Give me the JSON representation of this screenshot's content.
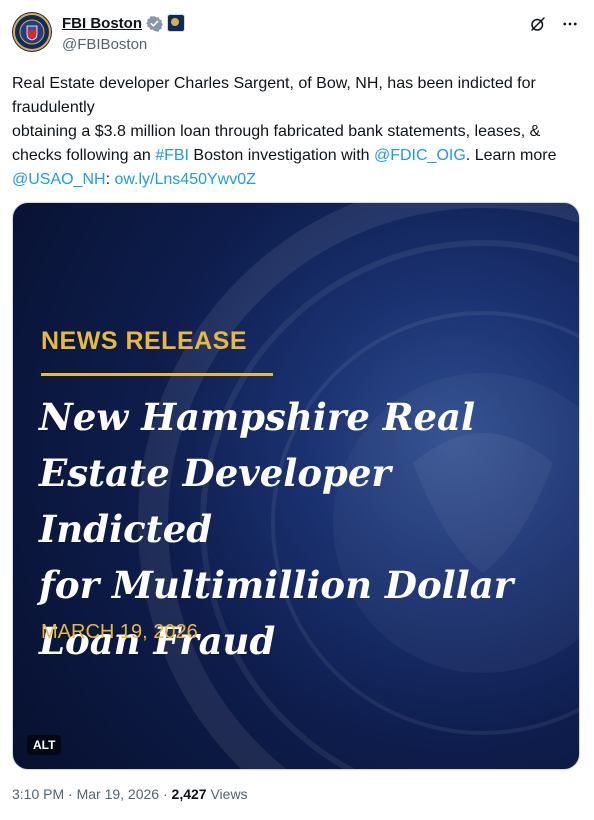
{
  "account": {
    "name": "FBI Boston",
    "handle": "@FBIBoston"
  },
  "tweet": {
    "line1": "Real Estate developer Charles Sargent, of Bow, NH, has been indicted for fraudulently",
    "line2_pre": "obtaining a $3.8 million loan through fabricated bank statements, leases, & checks following an ",
    "hashtag": "#FBI",
    "line2_mid": " Boston investigation with ",
    "mention1": "@FDIC_OIG",
    "line2_post": ". Learn more ",
    "mention2": "@USAO_NH",
    "colon": ": ",
    "url": "ow.ly/Lns450Ywv0Z"
  },
  "media": {
    "label": "NEWS RELEASE",
    "headline_lines": [
      "New Hampshire Real",
      "Estate Developer Indicted",
      "for Multimillion Dollar",
      "Loan Fraud"
    ],
    "date": "MARCH 19, 2026",
    "alt": "ALT"
  },
  "meta": {
    "time": "3:10 PM · Mar 19, 2026 · ",
    "views_count": "2,427",
    "views_label": " Views"
  },
  "icons": {
    "verified": "verified-badge-icon",
    "affiliate": "affiliate-seal-icon",
    "grok": "grok-icon",
    "more": "more-icon"
  },
  "colors": {
    "link": "#1d9bf0",
    "verified": "#829aab",
    "gold": "#e8b93a",
    "navy": "#0e1d4d"
  }
}
